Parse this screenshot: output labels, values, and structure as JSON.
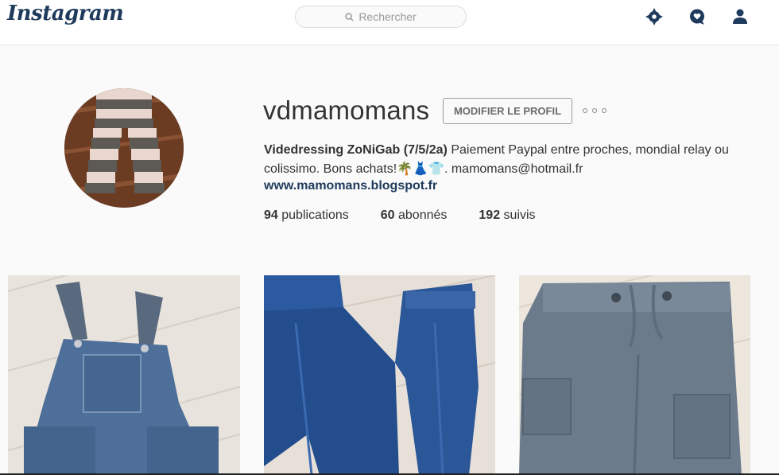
{
  "header": {
    "logo": "Instagram",
    "search_placeholder": "Rechercher",
    "icons": [
      "explore-icon",
      "activity-icon",
      "profile-icon"
    ]
  },
  "profile": {
    "username": "vdmamomans",
    "edit_label": "MODIFIER LE PROFIL",
    "bio_name": "Videdressing ZoNiGab (7/5/2a)",
    "bio_text": " Paiement Paypal entre proches, mondial relay ou colissimo. Bons achats!🌴👗👕. mamomans@hotmail.fr",
    "website": "www.mamomans.blogspot.fr",
    "stats": {
      "posts_count": "94",
      "posts_label": " publications",
      "followers_count": "60",
      "followers_label": " abonnés",
      "following_count": "192",
      "following_label": " suivis"
    }
  },
  "colors": {
    "brand": "#1e3a5c",
    "text": "#262626",
    "background": "#fafafa"
  },
  "posts": [
    "denim-overalls-photo",
    "blue-jeans-photo",
    "grey-cargo-pants-photo"
  ]
}
